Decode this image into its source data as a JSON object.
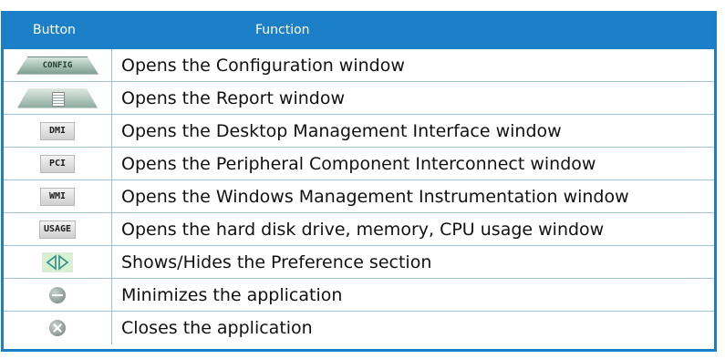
{
  "table": {
    "header": {
      "button": "Button",
      "function": "Function"
    },
    "rows": [
      {
        "icon": "config-button-icon",
        "icon_text": "CONFIG",
        "function": "Opens the Configuration window"
      },
      {
        "icon": "report-button-icon",
        "icon_text": "",
        "function": "Opens the Report window"
      },
      {
        "icon": "dmi-button-icon",
        "icon_text": "DMI",
        "function": "Opens the Desktop Management Interface window"
      },
      {
        "icon": "pci-button-icon",
        "icon_text": "PCI",
        "function": "Opens the Peripheral Component Interconnect window"
      },
      {
        "icon": "wmi-button-icon",
        "icon_text": "WMI",
        "function": "Opens the Windows Management Instrumentation window"
      },
      {
        "icon": "usage-button-icon",
        "icon_text": "USAGE",
        "function": "Opens the hard disk drive, memory, CPU usage window"
      },
      {
        "icon": "show-hide-arrows-icon",
        "icon_text": "",
        "function": "Shows/Hides the Preference section"
      },
      {
        "icon": "minimize-icon",
        "icon_text": "",
        "function": "Minimizes the application"
      },
      {
        "icon": "close-icon",
        "icon_text": "",
        "function": "Closes the application"
      }
    ]
  },
  "colors": {
    "header_bg": "#1b80c8",
    "border": "#1a7fc6",
    "row_divider": "#9fc3dd"
  }
}
